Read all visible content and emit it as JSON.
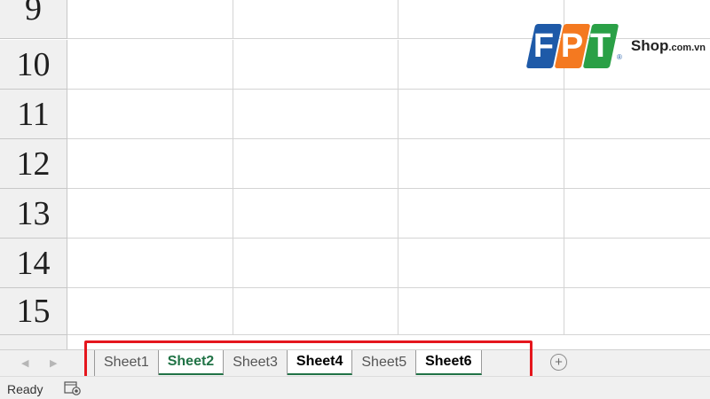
{
  "grid": {
    "rows": [
      {
        "number": "9"
      },
      {
        "number": "10"
      },
      {
        "number": "11"
      },
      {
        "number": "12"
      },
      {
        "number": "13"
      },
      {
        "number": "14"
      },
      {
        "number": "15",
        "active": true
      }
    ]
  },
  "logo": {
    "letters": [
      "F",
      "P",
      "T"
    ],
    "letter_colors": [
      "#1e5aa8",
      "#f47920",
      "#2aa046"
    ],
    "shop": "Shop",
    "domain": ".com.vn",
    "registered": "®"
  },
  "sheet_tabs": [
    {
      "label": "Sheet1"
    },
    {
      "label": "Sheet2",
      "active": true
    },
    {
      "label": "Sheet3"
    },
    {
      "label": "Sheet4",
      "selected": true,
      "bold": true
    },
    {
      "label": "Sheet5"
    },
    {
      "label": "Sheet6",
      "selected": true,
      "bold": true
    }
  ],
  "tab_nav": {
    "left_icon": "triangle-left-icon",
    "right_icon": "triangle-right-icon"
  },
  "add_sheet": {
    "label": "+",
    "icon": "plus-circle-icon"
  },
  "status": {
    "text": "Ready",
    "icon": "macro-record-icon"
  },
  "colors": {
    "excel_green": "#217346",
    "highlight_red": "#e5161d"
  }
}
